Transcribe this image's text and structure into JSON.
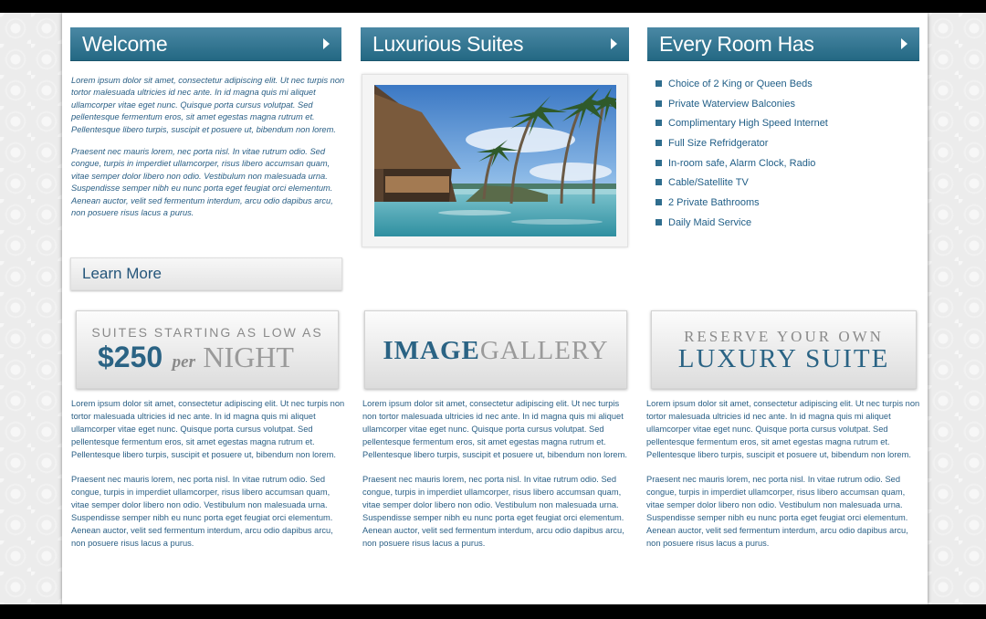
{
  "welcome": {
    "title": "Welcome",
    "paragraphs": [
      "Lorem ipsum dolor sit amet, consectetur adipiscing elit. Ut nec turpis non tortor malesuada ultricies id nec ante. In id magna quis mi aliquet ullamcorper vitae eget nunc. Quisque porta cursus volutpat. Sed pellentesque fermentum eros, sit amet egestas magna rutrum et. Pellentesque libero turpis, suscipit et posuere ut, bibendum non lorem.",
      "Praesent nec mauris lorem, nec porta nisl. In vitae rutrum odio. Sed congue, turpis in imperdiet ullamcorper, risus libero accumsan quam, vitae semper dolor libero non odio. Vestibulum non malesuada urna. Suspendisse semper nibh eu nunc porta eget feugiat orci elementum. Aenean auctor, velit sed fermentum interdum, arcu odio dapibus arcu, non posuere risus lacus a purus."
    ],
    "button": "Learn More"
  },
  "suites": {
    "title": "Luxurious Suites"
  },
  "room": {
    "title": "Every Room Has",
    "features": [
      "Choice of 2 King or Queen Beds",
      "Private Waterview Balconies",
      "Complimentary High Speed Internet",
      "Full Size Refridgerator",
      "In-room safe, Alarm Clock, Radio",
      "Cable/Satellite TV",
      "2 Private Bathrooms",
      "Daily Maid Service"
    ]
  },
  "promos": {
    "price": {
      "line1": "SUITES STARTING AS LOW AS",
      "amount": "$250",
      "per": "per",
      "night": "NIGHT"
    },
    "gallery": {
      "bold": "IMAGE",
      "light": "GALLERY"
    },
    "reserve": {
      "line1": "RESERVE YOUR OWN",
      "line2": "LUXURY SUITE"
    }
  },
  "columns": [
    {
      "paragraphs": [
        "Lorem ipsum dolor sit amet, consectetur adipiscing elit. Ut nec turpis non tortor malesuada ultricies id nec ante. In id magna quis mi aliquet ullamcorper vitae eget nunc. Quisque porta cursus volutpat. Sed pellentesque fermentum eros, sit amet egestas magna rutrum et. Pellentesque libero turpis, suscipit et posuere ut, bibendum non lorem.",
        "Praesent nec mauris lorem, nec porta nisl. In vitae rutrum odio. Sed congue, turpis in imperdiet ullamcorper, risus libero accumsan quam, vitae semper dolor libero non odio. Vestibulum non malesuada urna. Suspendisse semper nibh eu nunc porta eget feugiat orci elementum. Aenean auctor, velit sed fermentum interdum, arcu odio dapibus arcu, non posuere risus lacus a purus."
      ]
    },
    {
      "paragraphs": [
        "Lorem ipsum dolor sit amet, consectetur adipiscing elit. Ut nec turpis non tortor malesuada ultricies id nec ante. In id magna quis mi aliquet ullamcorper vitae eget nunc. Quisque porta cursus volutpat. Sed pellentesque fermentum eros, sit amet egestas magna rutrum et. Pellentesque libero turpis, suscipit et posuere ut, bibendum non lorem.",
        "Praesent nec mauris lorem, nec porta nisl. In vitae rutrum odio. Sed congue, turpis in imperdiet ullamcorper, risus libero accumsan quam, vitae semper dolor libero non odio. Vestibulum non malesuada urna. Suspendisse semper nibh eu nunc porta eget feugiat orci elementum. Aenean auctor, velit sed fermentum interdum, arcu odio dapibus arcu, non posuere risus lacus a purus."
      ]
    },
    {
      "paragraphs": [
        "Lorem ipsum dolor sit amet, consectetur adipiscing elit. Ut nec turpis non tortor malesuada ultricies id nec ante. In id magna quis mi aliquet ullamcorper vitae eget nunc. Quisque porta cursus volutpat. Sed pellentesque fermentum eros, sit amet egestas magna rutrum et. Pellentesque libero turpis, suscipit et posuere ut, bibendum non lorem.",
        "Praesent nec mauris lorem, nec porta nisl. In vitae rutrum odio. Sed congue, turpis in imperdiet ullamcorper, risus libero accumsan quam, vitae semper dolor libero non odio. Vestibulum non malesuada urna. Suspendisse semper nibh eu nunc porta eget feugiat orci elementum. Aenean auctor, velit sed fermentum interdum, arcu odio dapibus arcu, non posuere risus lacus a purus."
      ]
    }
  ],
  "colors": {
    "header_top": "#4a88a4",
    "header_bottom": "#236883",
    "text_blue": "#2a5f85",
    "promo_blue": "#2a6384",
    "promo_gray": "#8a8a8a"
  }
}
